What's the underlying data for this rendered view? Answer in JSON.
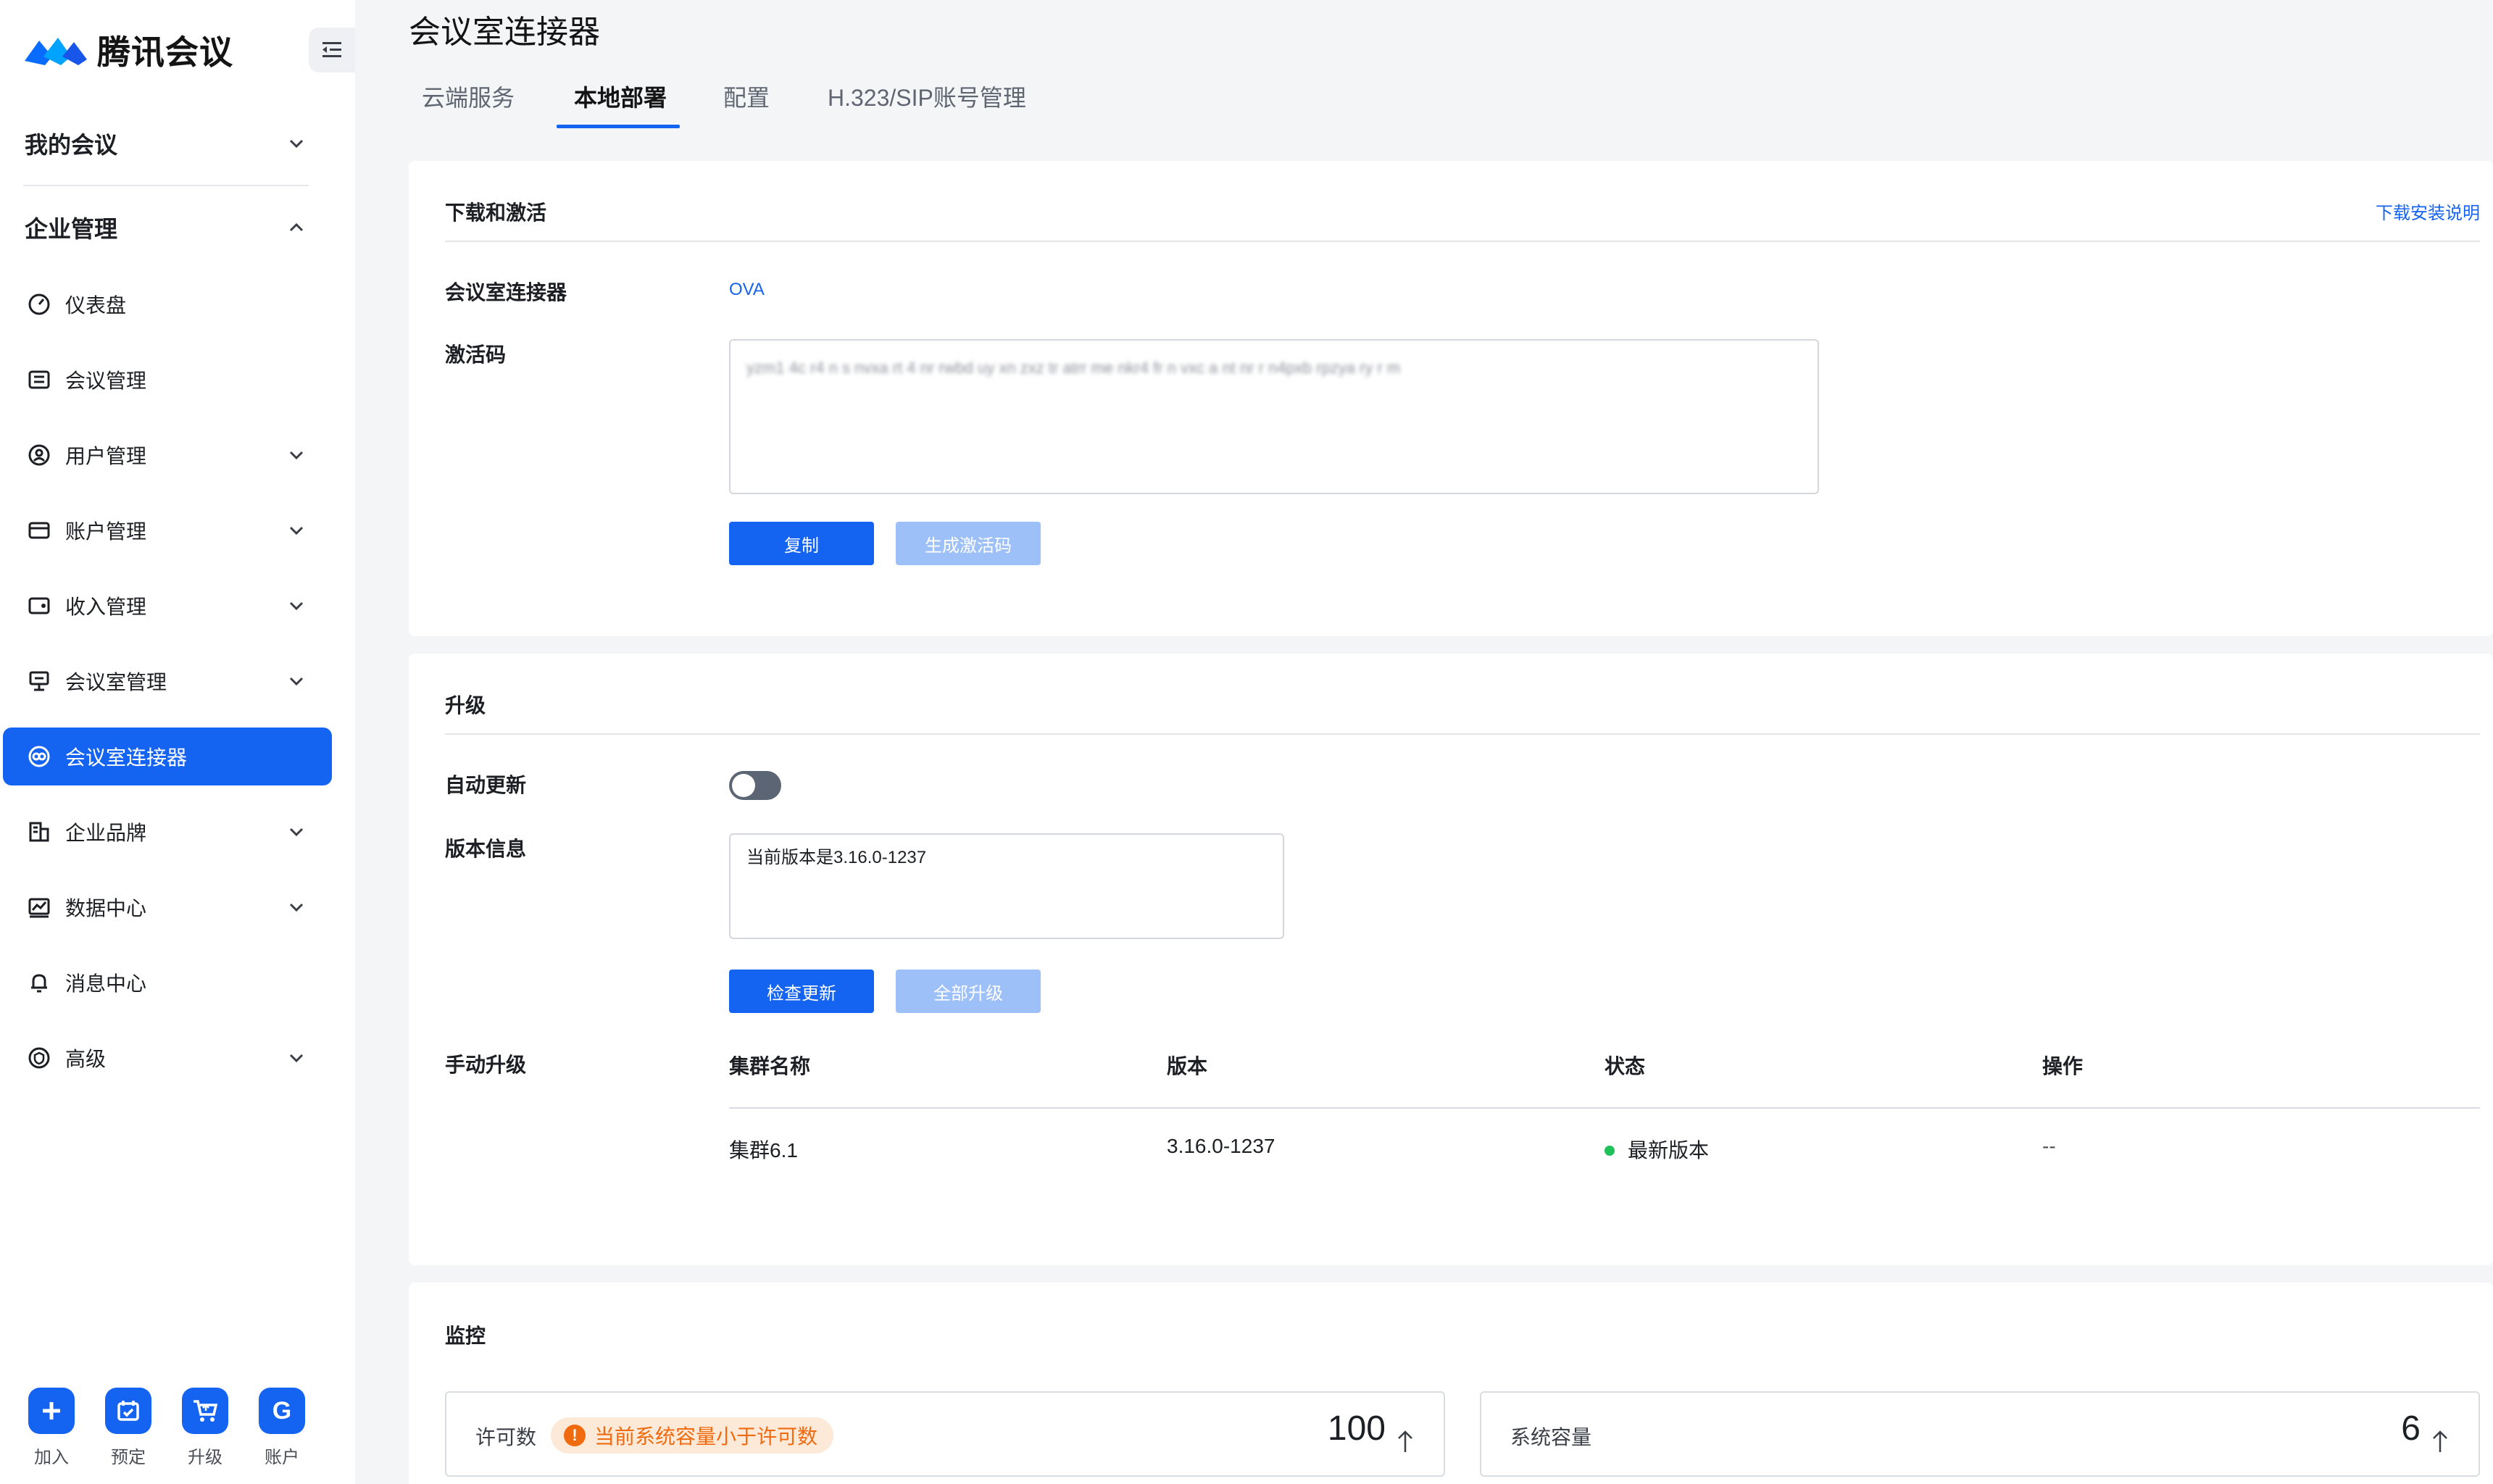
{
  "app": {
    "brand": "腾讯会议"
  },
  "sidebar": {
    "groups": [
      {
        "label": "我的会议",
        "expanded": false
      },
      {
        "label": "企业管理",
        "expanded": true
      }
    ],
    "items": [
      {
        "label": "仪表盘",
        "icon": "dashboard-icon",
        "expandable": false
      },
      {
        "label": "会议管理",
        "icon": "meeting-list-icon",
        "expandable": false
      },
      {
        "label": "用户管理",
        "icon": "user-icon",
        "expandable": true
      },
      {
        "label": "账户管理",
        "icon": "account-card-icon",
        "expandable": true
      },
      {
        "label": "收入管理",
        "icon": "wallet-icon",
        "expandable": true
      },
      {
        "label": "会议室管理",
        "icon": "meeting-room-icon",
        "expandable": true
      },
      {
        "label": "会议室连接器",
        "icon": "connector-icon",
        "expandable": false,
        "active": true
      },
      {
        "label": "企业品牌",
        "icon": "building-icon",
        "expandable": true
      },
      {
        "label": "数据中心",
        "icon": "chart-icon",
        "expandable": true
      },
      {
        "label": "消息中心",
        "icon": "bell-icon",
        "expandable": false
      },
      {
        "label": "高级",
        "icon": "shield-icon",
        "expandable": true
      }
    ],
    "bottom": [
      {
        "label": "加入",
        "icon": "plus-icon"
      },
      {
        "label": "预定",
        "icon": "calendar-icon"
      },
      {
        "label": "升级",
        "icon": "cart-icon"
      },
      {
        "label": "账户",
        "icon": "avatar-icon",
        "text": "G"
      }
    ]
  },
  "page": {
    "title": "会议室连接器",
    "tabs": [
      "云端服务",
      "本地部署",
      "配置",
      "H.323/SIP账号管理"
    ],
    "active_tab": "本地部署"
  },
  "download": {
    "title": "下载和激活",
    "install_link": "下载安装说明",
    "connector_label": "会议室连接器",
    "connector_value": "OVA",
    "code_label": "激活码",
    "code_text": "yzm1 4c r4 n s nvxa rt 4 nr rwbd uy xn zxz tr atrr me nkr4 fr n vxc a nt nr r n4pxb rpzya ry r m",
    "copy_button": "复制",
    "generate_button": "生成激活码"
  },
  "upgrade": {
    "title": "升级",
    "auto_label": "自动更新",
    "auto_enabled": false,
    "version_label": "版本信息",
    "version_text": "当前版本是3.16.0-1237",
    "check_button": "检查更新",
    "upgrade_all_button": "全部升级",
    "manual_label": "手动升级",
    "table": {
      "headers": [
        "集群名称",
        "版本",
        "状态",
        "操作"
      ],
      "rows": [
        {
          "name": "集群6.1",
          "version": "3.16.0-1237",
          "status": "最新版本",
          "action": "--"
        }
      ]
    }
  },
  "monitor": {
    "title": "监控",
    "license_label": "许可数",
    "license_warning": "当前系统容量小于许可数",
    "license_value": "100",
    "capacity_label": "系统容量",
    "capacity_value": "6"
  },
  "colors": {
    "accent": "#1563f1",
    "accent_disabled": "#9ec0f8",
    "warning": "#f06a0f",
    "success": "#1fc15b"
  }
}
